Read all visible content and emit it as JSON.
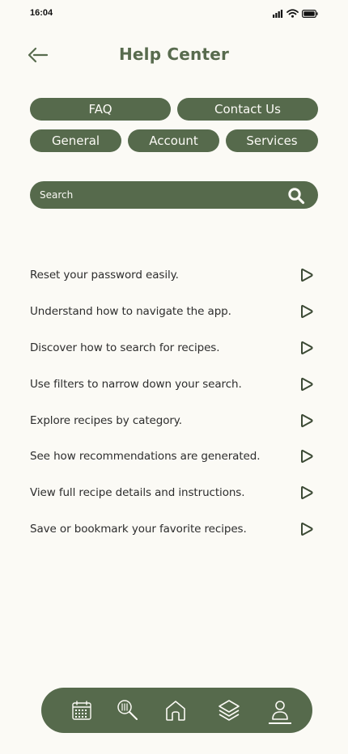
{
  "status_bar": {
    "time": "16:04",
    "icons": [
      "signal-icon",
      "wifi-icon",
      "battery-icon"
    ]
  },
  "header": {
    "title": "Help Center",
    "back_icon": "back-arrow-icon"
  },
  "tabs": {
    "row1": [
      "FAQ",
      "Contact Us"
    ],
    "row2": [
      "General",
      "Account",
      "Services"
    ]
  },
  "search": {
    "placeholder": "Search",
    "icon": "search-icon"
  },
  "faq_items": [
    "Reset your password easily.",
    "Understand how to navigate the app.",
    "Discover how to search for recipes.",
    "Use filters to narrow down your search.",
    "Explore recipes by category.",
    "See how recommendations are generated.",
    "View full recipe details and instructions.",
    "Save or bookmark your favorite recipes."
  ],
  "bottom_nav": {
    "items": [
      "calendar-icon",
      "recipe-search-icon",
      "home-icon",
      "layers-icon",
      "profile-icon"
    ],
    "active": "profile-icon"
  },
  "colors": {
    "primary": "#566a4c",
    "title": "#586b4e",
    "background": "#fbfaf5",
    "text": "#2d2d2d"
  }
}
